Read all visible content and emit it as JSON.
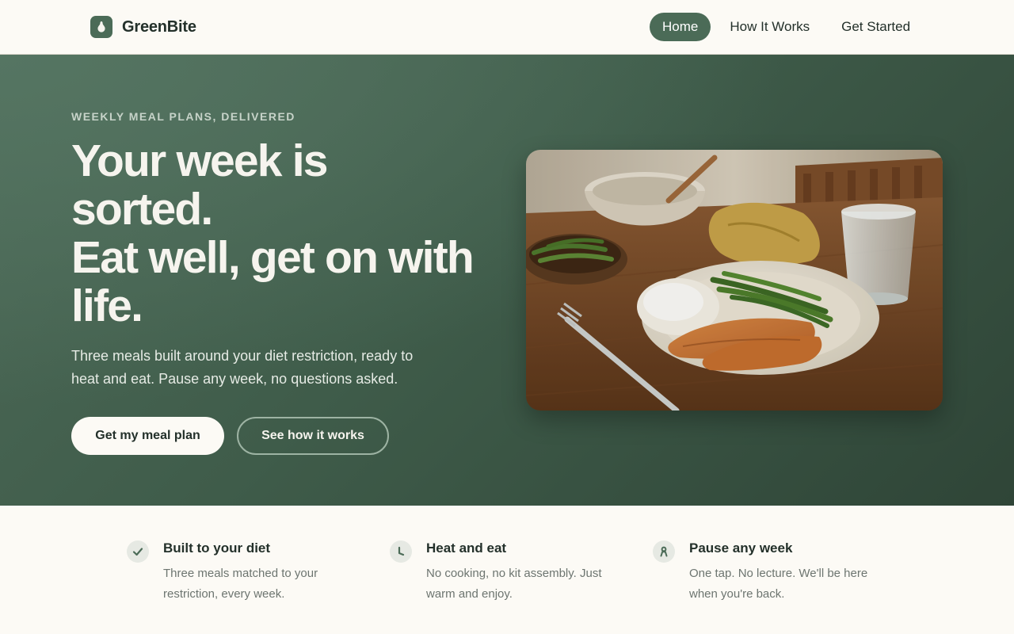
{
  "nav": {
    "brand": "GreenBite",
    "links": [
      {
        "label": "Home"
      },
      {
        "label": "How It Works"
      },
      {
        "label": "Get Started"
      }
    ]
  },
  "hero": {
    "eyebrow": "WEEKLY MEAL PLANS, DELIVERED",
    "headline_lines": [
      "Your week is",
      "sorted.",
      "Eat well, get on with",
      "life."
    ],
    "subcopy_lines": [
      "Three meals built around your diet restriction, ready to",
      "heat and eat. Pause any week, no questions asked."
    ],
    "primary_cta": "Get my meal plan",
    "secondary_cta": "See how it works",
    "image": "plated salmon with rice, green beans, fork, bowls and glass of water on a wooden table"
  },
  "features": [
    {
      "icon": "check-icon",
      "title": "Built to your diet",
      "desc_lines": [
        "Three meals matched to your",
        "restriction, every week."
      ]
    },
    {
      "icon": "clock-icon",
      "title": "Heat and eat",
      "desc_lines": [
        "No cooking, no kit assembly. Just",
        "warm and enjoy."
      ]
    },
    {
      "icon": "person-icon",
      "title": "Pause any week",
      "desc_lines": [
        "One tap. No lecture. We'll be here",
        "when you're back."
      ]
    }
  ],
  "colors": {
    "accent": "#4b6b57",
    "hero_bg": "#3f5c4a",
    "cream": "#fcfaf5",
    "text_dark": "#23302a",
    "muted": "#6d7570"
  }
}
